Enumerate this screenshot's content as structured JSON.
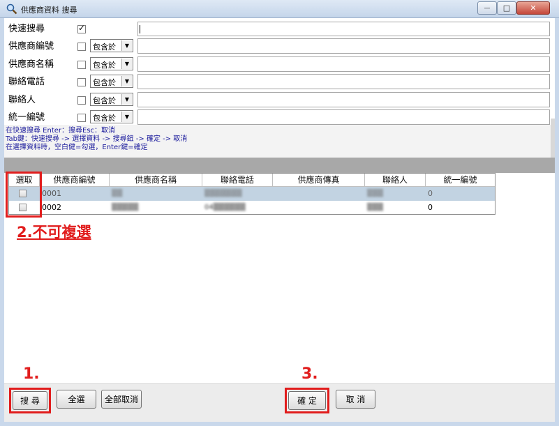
{
  "window": {
    "title": "供應商資料 搜尋",
    "minimize_glyph": "—",
    "maximize_glyph": "□",
    "close_glyph": "✕"
  },
  "search": {
    "fields": [
      {
        "label": "快速搜尋",
        "checked": true
      },
      {
        "label": "供應商編號",
        "checked": false,
        "operator": "包含於"
      },
      {
        "label": "供應商名稱",
        "checked": false,
        "operator": "包含於"
      },
      {
        "label": "聯絡電話",
        "checked": false,
        "operator": "包含於"
      },
      {
        "label": "聯絡人",
        "checked": false,
        "operator": "包含於"
      },
      {
        "label": "統一編號",
        "checked": false,
        "operator": "包含於"
      }
    ],
    "hints": [
      "在快速搜尋 Enter：搜尋Esc：取消",
      "Tab鍵：快速搜尋 -> 選擇資料 -> 搜尋鈕 -> 確定 -> 取消",
      "在選擇資料時，空白健=勾選，Enter鍵=確定"
    ]
  },
  "grid": {
    "columns": [
      "選取",
      "供應商編號",
      "供應商名稱",
      "聯絡電話",
      "供應商傳真",
      "聯絡人",
      "統一編號"
    ],
    "rows": [
      {
        "code": "0001",
        "name": "▒▒",
        "phone": "▒▒▒▒▒▒▒",
        "fax": "",
        "contact": "▒▒▒",
        "tax_id": "0"
      },
      {
        "code": "0002",
        "name": "▒▒▒▒▒",
        "phone": "04▒▒▒▒▒▒",
        "fax": "",
        "contact": "▒▒▒",
        "tax_id": "0"
      }
    ]
  },
  "annotations": {
    "step1": "1.",
    "step2": "2.不可複選",
    "step3": "3.",
    "color": "#e11d1d"
  },
  "buttons": {
    "search": "搜 尋",
    "select_all": "全選",
    "deselect_all": "全部取消",
    "ok": "確 定",
    "cancel": "取 消"
  }
}
